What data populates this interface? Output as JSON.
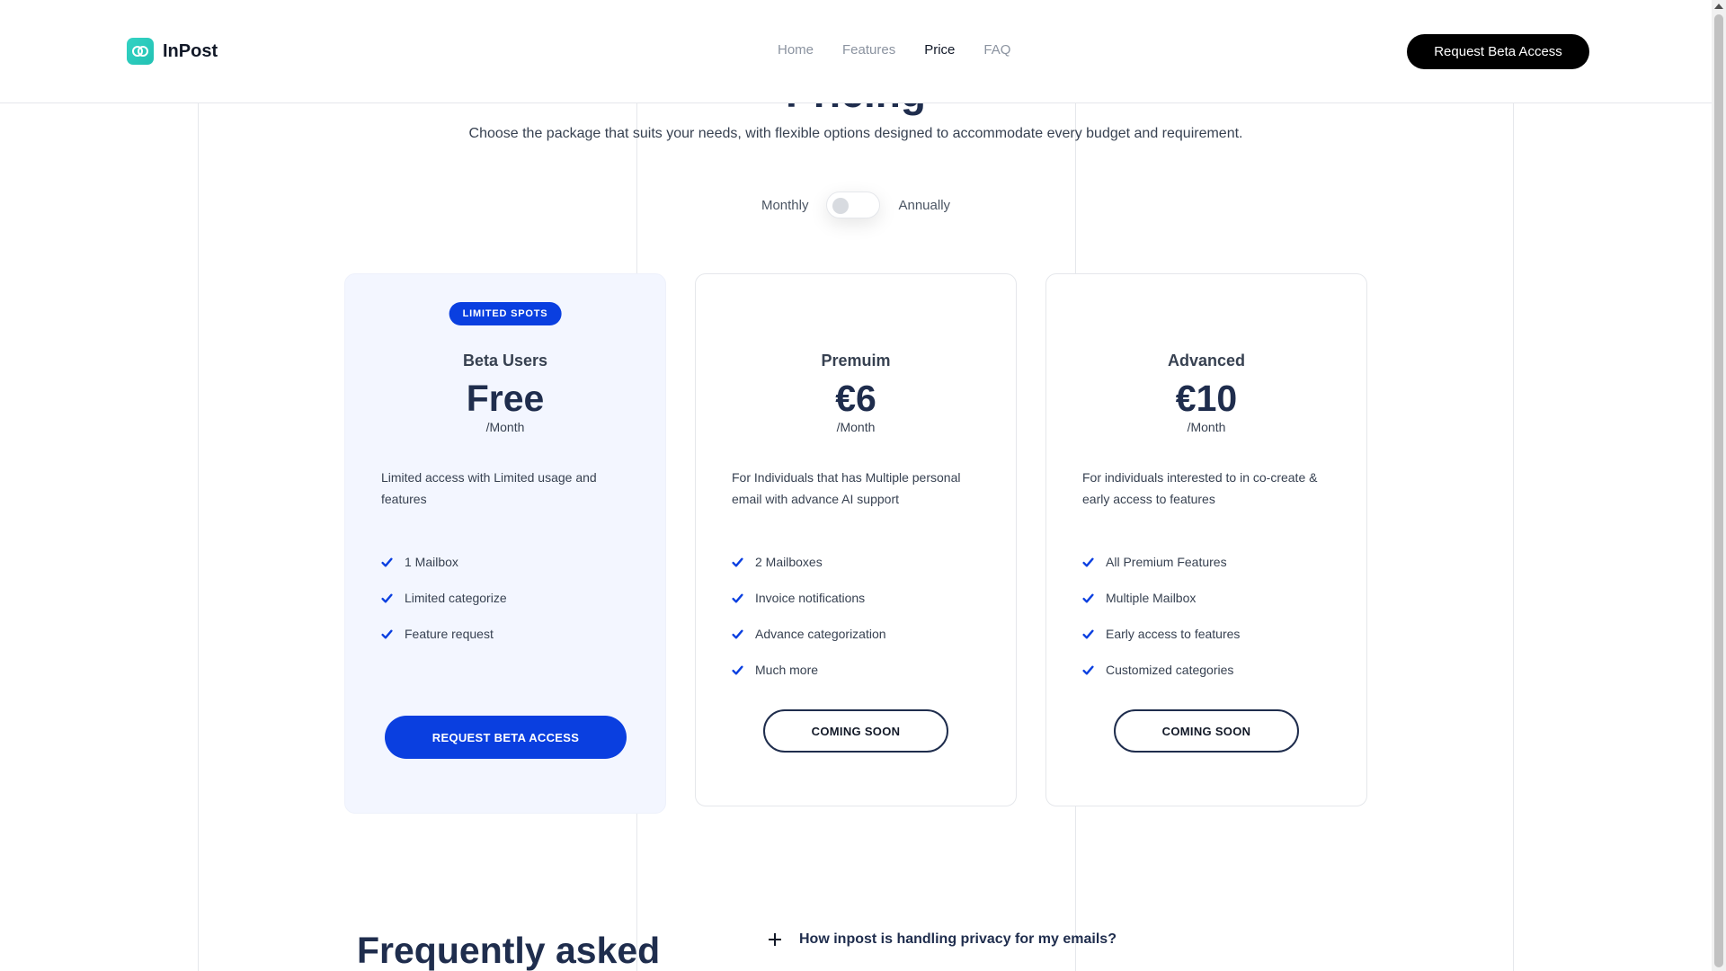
{
  "brand": {
    "name": "InPost",
    "logo_icon": "link-icon",
    "accent": "#2ec9bb"
  },
  "nav": {
    "items": [
      {
        "label": "Home",
        "active": false
      },
      {
        "label": "Features",
        "active": false
      },
      {
        "label": "Price",
        "active": true
      },
      {
        "label": "FAQ",
        "active": false
      }
    ],
    "cta_label": "Request Beta Access"
  },
  "pricing": {
    "title": "Pricing",
    "subtitle": "Choose the package that suits your needs, with flexible options designed to accommodate every budget and requirement.",
    "toggle": {
      "left_label": "Monthly",
      "right_label": "Annually",
      "annual_selected": false
    },
    "plans": [
      {
        "badge": "LIMITED SPOTS",
        "name": "Beta Users",
        "price": "Free",
        "period": "/Month",
        "description": "Limited access with Limited usage and features",
        "features": [
          "1 Mailbox",
          "Limited categorize",
          "Feature request"
        ],
        "button_label": "REQUEST BETA ACCESS"
      },
      {
        "name": "Premuim",
        "price": "€6",
        "period": "/Month",
        "description": "For Individuals that has Multiple personal email with advance AI support",
        "features": [
          "2 Mailboxes",
          "Invoice notifications",
          "Advance categorization",
          "Much more"
        ],
        "button_label": "COMING SOON"
      },
      {
        "name": "Advanced",
        "price": "€10",
        "period": "/Month",
        "description": "For individuals interested to in co-create & early access to features",
        "features": [
          "All Premium Features",
          "Multiple Mailbox",
          "Early access to features",
          "Customized categories"
        ],
        "button_label": "COMING SOON"
      }
    ],
    "colors": {
      "primary": "#0a3fe0",
      "heading": "#1f2d4d",
      "featured_bg": "#f3f6ff"
    }
  },
  "faq": {
    "title": "Frequently asked",
    "questions": [
      "How inpost is handling privacy for my emails?"
    ]
  }
}
